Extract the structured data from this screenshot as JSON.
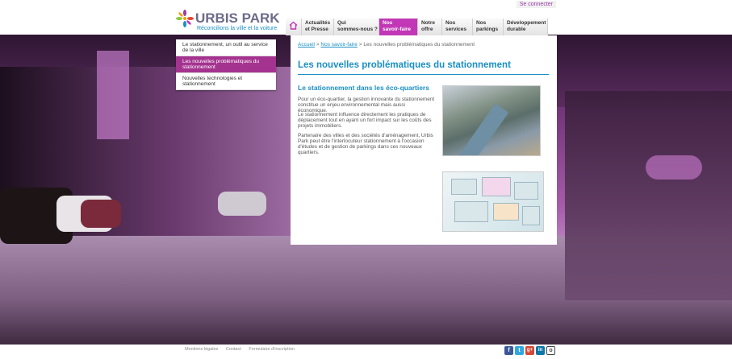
{
  "header": {
    "brand_name": "URBIS PARK",
    "tagline": "Réconcilions la ville et la voiture",
    "login_link": "Se connecter"
  },
  "nav": {
    "items": [
      {
        "label": "Actualités\net Presse",
        "l1": "Actualités",
        "l2": "et Presse"
      },
      {
        "label": "Qui sommes-nous ?",
        "l1": "Qui",
        "l2": "sommes-nous ?"
      },
      {
        "label": "Nos savoir-faire",
        "l1": "Nos",
        "l2": "savoir-faire",
        "active": true
      },
      {
        "label": "Notre offre",
        "l1": "Notre",
        "l2": "offre"
      },
      {
        "label": "Nos services",
        "l1": "Nos",
        "l2": "services"
      },
      {
        "label": "Nos parkings",
        "l1": "Nos",
        "l2": "parkings"
      },
      {
        "label": "Développement durable",
        "l1": "Développement",
        "l2": "durable"
      }
    ]
  },
  "submenu": {
    "items": [
      {
        "label": "Le stationnement, un outil au service de la ville"
      },
      {
        "label": "Les nouvelles problématiques du stationnement",
        "active": true
      },
      {
        "label": "Nouvelles technologies et stationnement"
      }
    ]
  },
  "breadcrumb": {
    "home": "Accueil",
    "parent": "Nos savoir-faire",
    "current": "Les nouvelles problématiques du stationnement",
    "sep": ">"
  },
  "main": {
    "title": "Les nouvelles problématiques du stationnement",
    "section_title": "Le stationnement dans les éco-quartiers",
    "paragraphs": [
      "Pour un éco-quartier, la gestion innovante du stationnement constitue un enjeu environnemental mais aussi économique.",
      "Le stationnement influence directement les pratiques de déplacement tout en ayant un fort impact sur les coûts des projets immobiliers.",
      "Partenaire des villes et des sociétés d'aménagement, Urbis Park peut être l'interlocuteur stationnement à l'occasion d'études et de gestion de parkings dans ces nouveaux quartiers."
    ]
  },
  "footer": {
    "links": [
      "Mentions légales",
      "Contact",
      "Formulaire d'inscription"
    ],
    "social": [
      {
        "name": "facebook-icon",
        "glyph": "f",
        "color": "#3b5998"
      },
      {
        "name": "twitter-icon",
        "glyph": "t",
        "color": "#2fa8e0"
      },
      {
        "name": "google-plus-icon",
        "glyph": "g+",
        "color": "#d34836"
      },
      {
        "name": "linkedin-icon",
        "glyph": "in",
        "color": "#0e76a8"
      },
      {
        "name": "other-social-icon",
        "glyph": "o",
        "color": "#444444"
      }
    ]
  },
  "colors": {
    "accent_blue": "#1a8fc4",
    "accent_magenta": "#c137b6",
    "submenu_active": "#a4338f"
  }
}
